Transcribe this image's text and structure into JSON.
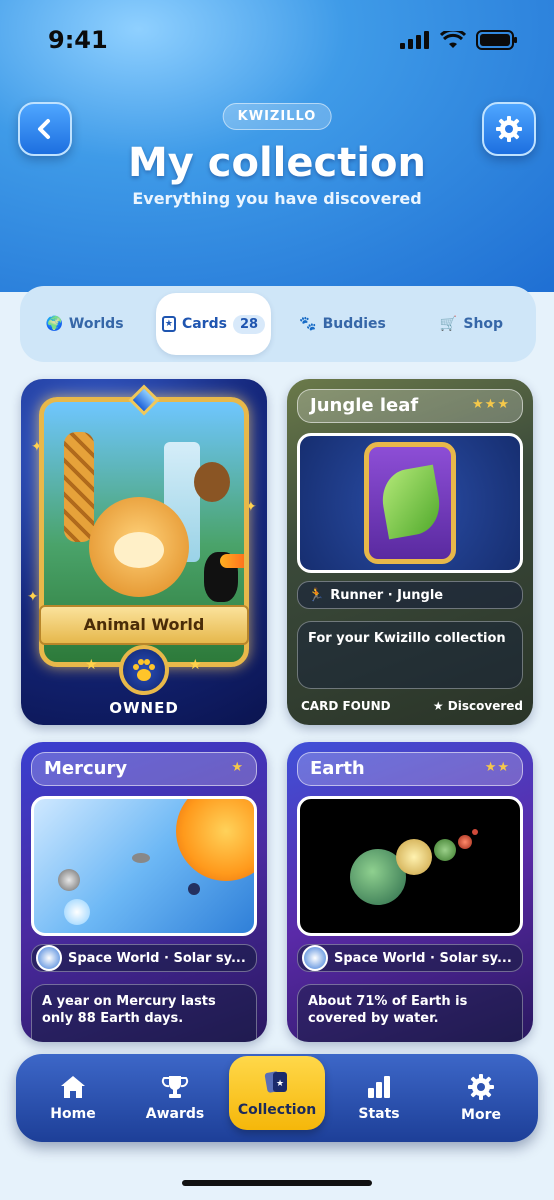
{
  "status": {
    "time": "9:41"
  },
  "header": {
    "brand": "KWIZILLO",
    "title": "My collection",
    "subtitle": "Everything you have discovered"
  },
  "tabs": [
    {
      "icon": "globe-icon",
      "glyph": "🌍",
      "label": "Worlds",
      "active": false
    },
    {
      "icon": "cards-icon",
      "glyph": "★",
      "label": "Cards",
      "count": "28",
      "active": true
    },
    {
      "icon": "paw-icon",
      "glyph": "🐾",
      "label": "Buddies",
      "active": false
    },
    {
      "icon": "cart-icon",
      "glyph": "🛒",
      "label": "Shop",
      "active": false
    }
  ],
  "cards": {
    "hero": {
      "label": "Animal World",
      "status": "OWNED"
    },
    "jungle": {
      "title": "Jungle leaf",
      "stars": "★★★",
      "meta": "Runner · Jungle",
      "fact": "For your Kwizillo collection",
      "footer_left": "CARD FOUND",
      "footer_right": "★ Discovered"
    },
    "mercury": {
      "title": "Mercury",
      "stars": "★",
      "meta": "Space World · Solar sy...",
      "fact": "A year on Mercury lasts only 88 Earth days."
    },
    "earth": {
      "title": "Earth",
      "stars": "★★",
      "meta": "Space World · Solar sy...",
      "fact": "About 71% of Earth is covered by water."
    }
  },
  "nav": [
    {
      "icon": "home-icon",
      "label": "Home"
    },
    {
      "icon": "trophy-icon",
      "label": "Awards"
    },
    {
      "icon": "collection-icon",
      "label": "Collection",
      "active": true
    },
    {
      "icon": "stats-icon",
      "label": "Stats"
    },
    {
      "icon": "more-gear-icon",
      "label": "More"
    }
  ],
  "colors": {
    "header_blue": "#1f6fd3",
    "accent_yellow": "#f5b70a",
    "nav_blue": "#2d52b0",
    "card_gold": "#e8b84a"
  }
}
